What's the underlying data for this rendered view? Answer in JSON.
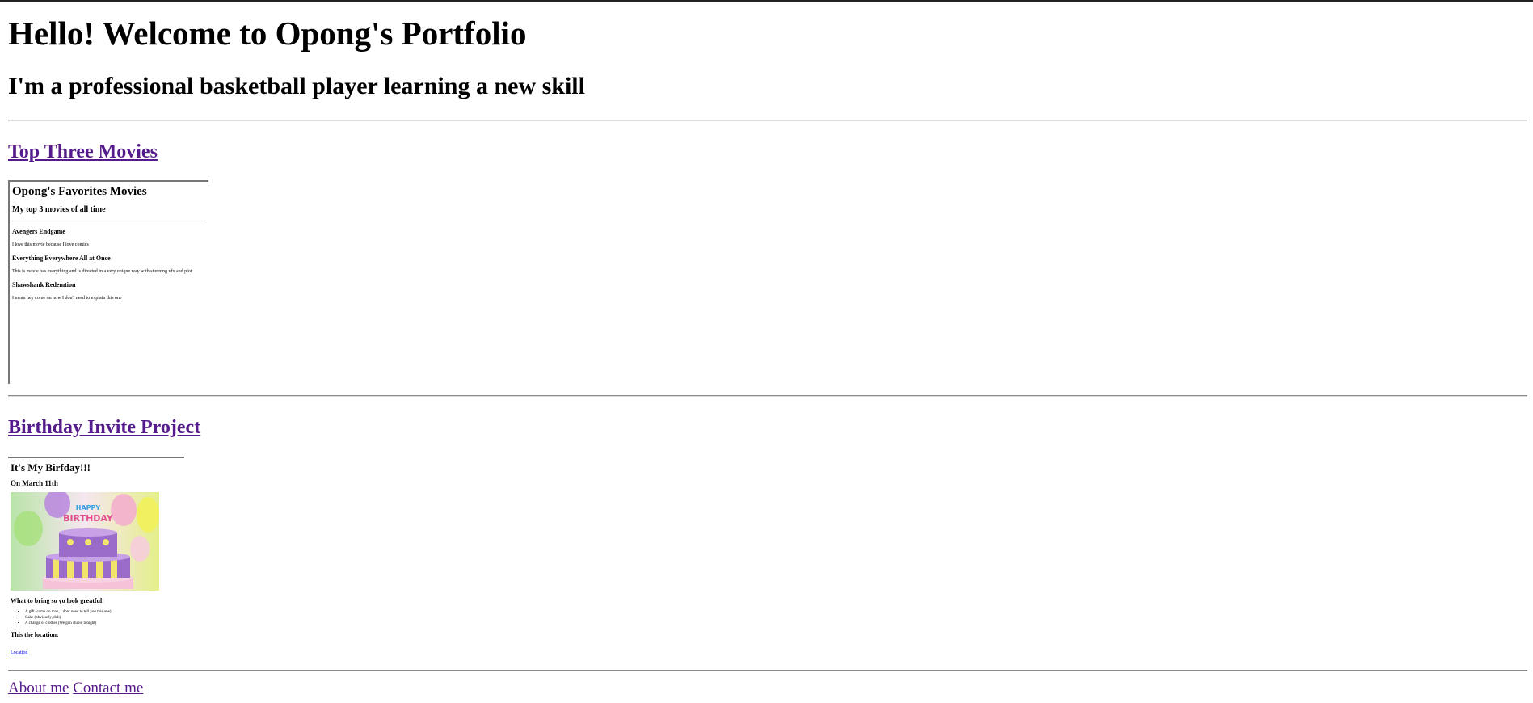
{
  "header": {
    "title": "Hello! Welcome to Opong's Portfolio",
    "subtitle": "I'm a professional basketball player learning a new skill"
  },
  "sections": {
    "movies": {
      "link_label": "Top Three Movies",
      "embed": {
        "title": "Opong's Favorites Movies",
        "subtitle": "My top 3 movies of all time",
        "movies": [
          {
            "name": "Avengers Endgame",
            "desc": "I love this movie because I love comics"
          },
          {
            "name": "Everything Everywhere All at Once",
            "desc": "This is movie has everything and is directed in a very unique way with stunning vfx and plot"
          },
          {
            "name": "Shawshank Redemtion",
            "desc": "I mean hey come on now I don't need to explain this one"
          }
        ]
      }
    },
    "birthday": {
      "link_label": "Birthday Invite Project",
      "embed": {
        "title": "It's My Birfday!!!",
        "subtitle": "On March 11th",
        "bring_heading": "What to bring so yo look greatful:",
        "bring_items": [
          "A gift (come on man, I dont need to tell you this one)",
          "Cake (obviously, duh)",
          "A change of clothes (We gon stupid tonight)"
        ],
        "location_heading": "This the location:",
        "location_link": "Location",
        "cake_image_text": "HAPPY BIRTHDAY"
      }
    }
  },
  "footer": {
    "about_label": "About me",
    "contact_label": "Contact me"
  },
  "colors": {
    "visited_link": "#551a8b",
    "link": "#0000ee",
    "rule": "#8a8a8a"
  }
}
